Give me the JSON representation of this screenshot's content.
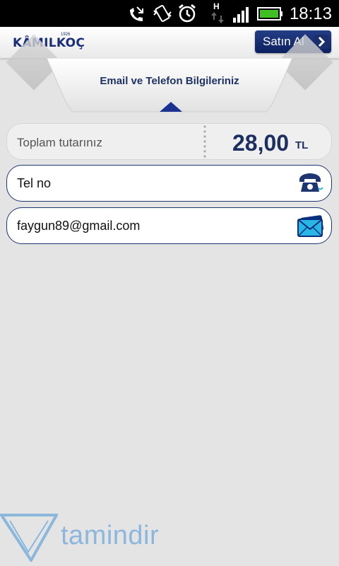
{
  "status_bar": {
    "time": "18:13",
    "network_type": "H",
    "icons": [
      "missed-call-icon",
      "vibrate-icon",
      "alarm-icon",
      "data-transfer-icon",
      "signal-icon",
      "battery-icon"
    ]
  },
  "header": {
    "logo_text": "KÂMILKOÇ",
    "logo_year": "1926",
    "buy_label": "Satın Al"
  },
  "tab": {
    "title": "Email ve Telefon Bilgileriniz"
  },
  "total": {
    "label": "Toplam tutarınız",
    "amount": "28,00",
    "currency": "TL"
  },
  "phone_field": {
    "placeholder": "Tel no",
    "value": "",
    "icon": "telephone-icon"
  },
  "email_field": {
    "placeholder": "",
    "value": "faygun89@gmail.com",
    "icon": "envelope-icon"
  },
  "watermark": {
    "text": "tamindir"
  },
  "colors": {
    "brand_navy": "#1a2f7a",
    "background": "#e4e4e4",
    "row_border": "#1d3570",
    "watermark": "#8cb7dc"
  }
}
